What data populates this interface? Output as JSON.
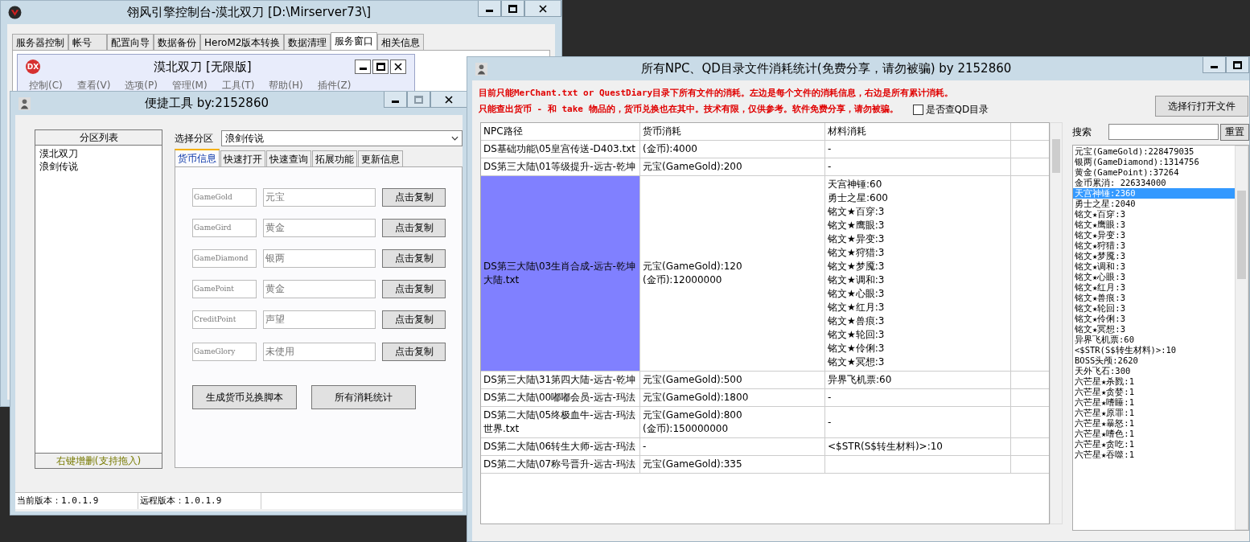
{
  "main_window": {
    "title": "翎风引擎控制台-漠北双刀 [D:\\Mirserver73\\]",
    "tabs": [
      {
        "label": "服务器控制",
        "selected": false
      },
      {
        "label": "帐号",
        "selected": false
      },
      {
        "label": "配置向导",
        "selected": false
      },
      {
        "label": "数据备份",
        "selected": false
      },
      {
        "label": "HeroM2版本转换",
        "selected": false
      },
      {
        "label": "数据清理",
        "selected": false
      },
      {
        "label": "服务窗口",
        "selected": true
      },
      {
        "label": "相关信息",
        "selected": false
      }
    ]
  },
  "child_window": {
    "icon_text": "DX",
    "title": "漠北双刀 [无限版]",
    "menu": [
      "控制(C)",
      "查看(V)",
      "选项(P)",
      "管理(M)",
      "工具(T)",
      "帮助(H)",
      "插件(Z)"
    ]
  },
  "tool_window": {
    "title": "便捷工具  by:2152860",
    "partition_list": {
      "header": "分区列表",
      "items": [
        "漠北双刀",
        "浪剑传说"
      ],
      "footer": "右键增删(支持拖入)"
    },
    "select_label": "选择分区",
    "select_value": "浪剑传说",
    "tabs": [
      {
        "label": "货币信息",
        "selected": true
      },
      {
        "label": "快速打开",
        "selected": false
      },
      {
        "label": "快速查询",
        "selected": false
      },
      {
        "label": "拓展功能",
        "selected": false
      },
      {
        "label": "更新信息",
        "selected": false
      }
    ],
    "currencies": [
      {
        "code": "GameGold",
        "name": "元宝",
        "button": "点击复制"
      },
      {
        "code": "GameGird",
        "name": "黄金",
        "button": "点击复制"
      },
      {
        "code": "GameDiamond",
        "name": "银两",
        "button": "点击复制"
      },
      {
        "code": "GamePoint",
        "name": "黄金",
        "button": "点击复制"
      },
      {
        "code": "CreditPoint",
        "name": "声望",
        "button": "点击复制"
      },
      {
        "code": "GameGlory",
        "name": "未使用",
        "button": "点击复制"
      }
    ],
    "buttons": [
      "生成货币兑换脚本",
      "所有消耗统计"
    ],
    "status_bar": [
      "当前版本：1.0.1.9",
      "远程版本：1.0.1.9"
    ]
  },
  "stats_window": {
    "title": "所有NPC、QD目录文件消耗统计(免费分享，请勿被骗)   by 2152860",
    "notes": [
      "目前只能MerChant.txt or QuestDiary目录下所有文件的消耗。左边是每个文件的消耗信息，右边是所有累计消耗。",
      "只能查出货币 - 和 take 物品的，货币兑换也在其中。技术有限，仅供参考。软件免费分享，请勿被骗。"
    ],
    "qd_checkbox": {
      "label": "是否查QD目录",
      "checked": false
    },
    "open_button": "选择行打开文件",
    "table": {
      "columns": [
        "NPC路径",
        "货币消耗",
        "材料消耗"
      ],
      "rows": [
        {
          "selected": false,
          "path": "DS基础功能\\05皇宫传送-D403.txt",
          "currency": [
            "(金币):4000"
          ],
          "materials": [
            "-"
          ]
        },
        {
          "selected": false,
          "path": "DS第三大陆\\01等级提升-远古-乾坤",
          "currency": [
            "元宝(GameGold):200"
          ],
          "materials": [
            "-"
          ]
        },
        {
          "selected": true,
          "path": "DS第三大陆\\03生肖合成-远古-乾坤大陆.txt",
          "currency": [
            "元宝(GameGold):120",
            "(金币):12000000"
          ],
          "materials": [
            "天宫神锤:60",
            "勇士之星:600",
            "铭文★百穿:3",
            "铭文★鹰眼:3",
            "铭文★异变:3",
            "铭文★狩猎:3",
            "铭文★梦魇:3",
            "铭文★调和:3",
            "铭文★心眼:3",
            "铭文★红月:3",
            "铭文★兽痕:3",
            "铭文★轮回:3",
            "铭文★伶俐:3",
            "铭文★冥想:3"
          ]
        },
        {
          "selected": false,
          "path": "DS第三大陆\\31第四大陆-远古-乾坤",
          "currency": [
            "元宝(GameGold):500"
          ],
          "materials": [
            "异界飞机票:60"
          ]
        },
        {
          "selected": false,
          "path": "DS第二大陆\\00嘟嘟会员-远古-玛法",
          "currency": [
            "元宝(GameGold):1800"
          ],
          "materials": [
            "-"
          ]
        },
        {
          "selected": false,
          "path": "DS第二大陆\\05终极血牛-远古-玛法世界.txt",
          "currency": [
            "元宝(GameGold):800",
            "(金币):150000000"
          ],
          "materials": [
            "-"
          ]
        },
        {
          "selected": false,
          "path": "DS第二大陆\\06转生大师-远古-玛法",
          "currency": [
            "-"
          ],
          "materials": [
            "<$STR(S$转生材料)>:10"
          ]
        },
        {
          "selected": false,
          "path": "DS第二大陆\\07称号晋升-远古-玛法",
          "currency": [
            "元宝(GameGold):335"
          ],
          "materials": []
        }
      ]
    },
    "search": {
      "label": "搜索",
      "button": "重置"
    },
    "totals": [
      {
        "text": "元宝(GameGold):228479035",
        "selected": false
      },
      {
        "text": "银两(GameDiamond):1314756",
        "selected": false
      },
      {
        "text": "黄金(GamePoint):37264",
        "selected": false
      },
      {
        "text": "金币累消: 226334000",
        "selected": false
      },
      {
        "text": "天宫神锤:2360",
        "selected": true
      },
      {
        "text": "勇士之星:2040",
        "selected": false
      },
      {
        "text": "铭文★百穿:3",
        "selected": false
      },
      {
        "text": "铭文★鹰眼:3",
        "selected": false
      },
      {
        "text": "铭文★异变:3",
        "selected": false
      },
      {
        "text": "铭文★狩猎:3",
        "selected": false
      },
      {
        "text": "铭文★梦魇:3",
        "selected": false
      },
      {
        "text": "铭文★调和:3",
        "selected": false
      },
      {
        "text": "铭文★心眼:3",
        "selected": false
      },
      {
        "text": "铭文★红月:3",
        "selected": false
      },
      {
        "text": "铭文★兽痕:3",
        "selected": false
      },
      {
        "text": "铭文★轮回:3",
        "selected": false
      },
      {
        "text": "铭文★伶俐:3",
        "selected": false
      },
      {
        "text": "铭文★冥想:3",
        "selected": false
      },
      {
        "text": "异界飞机票:60",
        "selected": false
      },
      {
        "text": "<$STR(S$转生材料)>:10",
        "selected": false
      },
      {
        "text": "BOSS头颅:2620",
        "selected": false
      },
      {
        "text": "天外飞石:300",
        "selected": false
      },
      {
        "text": "六芒星★杀戮:1",
        "selected": false
      },
      {
        "text": "六芒星★贪婪:1",
        "selected": false
      },
      {
        "text": "六芒星★嗜睡:1",
        "selected": false
      },
      {
        "text": "六芒星★原罪:1",
        "selected": false
      },
      {
        "text": "六芒星★暴怒:1",
        "selected": false
      },
      {
        "text": "六芒星★嗜色:1",
        "selected": false
      },
      {
        "text": "六芒星★贪吃:1",
        "selected": false
      },
      {
        "text": "六芒星★吞噬:1",
        "selected": false
      }
    ]
  }
}
